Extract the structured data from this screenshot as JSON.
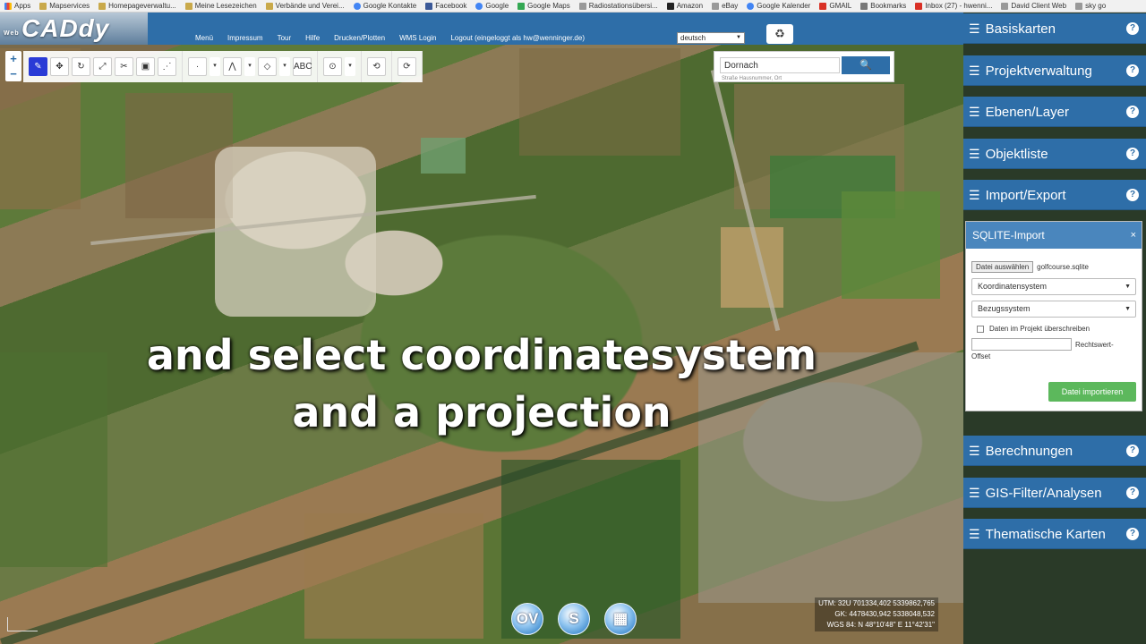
{
  "bookmarks": [
    {
      "label": "Apps",
      "icon": "apps"
    },
    {
      "label": "Mapservices",
      "icon": "folder"
    },
    {
      "label": "Homepageverwaltu...",
      "icon": "folder"
    },
    {
      "label": "Meine Lesezeichen",
      "icon": "folder"
    },
    {
      "label": "Verbände und Verei...",
      "icon": "folder"
    },
    {
      "label": "Google Kontakte",
      "icon": "g"
    },
    {
      "label": "Facebook",
      "icon": "fb"
    },
    {
      "label": "Google",
      "icon": "g"
    },
    {
      "label": "Google Maps",
      "icon": "maps"
    },
    {
      "label": "Radiostationsübersi...",
      "icon": "gray"
    },
    {
      "label": "Amazon",
      "icon": "amz"
    },
    {
      "label": "eBay",
      "icon": "gray"
    },
    {
      "label": "Google Kalender",
      "icon": "g"
    },
    {
      "label": "GMAIL",
      "icon": "red"
    },
    {
      "label": "Bookmarks",
      "icon": "star"
    },
    {
      "label": "Inbox (27) - hwenni...",
      "icon": "red"
    },
    {
      "label": "David Client Web",
      "icon": "gray"
    },
    {
      "label": "sky go",
      "icon": "gray"
    }
  ],
  "logo": {
    "text": "CADdy",
    "small": "Web"
  },
  "menu": [
    "Menü",
    "Impressum",
    "Tour",
    "Hilfe",
    "Drucken/Plotten",
    "WMS Login",
    "Logout (eingeloggt als hw@wenninger.de)"
  ],
  "language": "deutsch",
  "zoom": {
    "in": "+",
    "out": "−"
  },
  "toolbar": {
    "group1": [
      "✎",
      "✥",
      "↻",
      "⤢",
      "✂",
      "▣",
      "⋰"
    ],
    "group2": [
      "·",
      "▾",
      "⋀",
      "▾",
      "◇",
      "▾",
      "ABC"
    ],
    "group3": [
      "⊙",
      "▾"
    ],
    "group4": [
      "⟲"
    ],
    "group5": [
      "⟳"
    ]
  },
  "search": {
    "value": "Dornach",
    "hint": "Straße Hausnummer, Ort",
    "button": "🔍"
  },
  "panel": {
    "items_top": [
      "Basiskarten",
      "Projektverwaltung",
      "Ebenen/Layer",
      "Objektliste",
      "Import/Export"
    ],
    "items_bottom": [
      "Berechnungen",
      "GIS-Filter/Analysen",
      "Thematische Karten"
    ],
    "help": "?"
  },
  "sqlite": {
    "title": "SQLITE-Import",
    "close": "×",
    "file_button": "Datei auswählen",
    "file_name": "golfcourse.sqlite",
    "coord_system": "Koordinatensystem",
    "ref_system": "Bezugssystem",
    "overwrite": "Daten im Projekt überschreiben",
    "offset_label": "Rechtswert-",
    "offset_label2": "Offset",
    "import_button": "Datei importieren"
  },
  "caption": {
    "line1": "and select coordinatesystem",
    "line2": "and a projection"
  },
  "bottom_buttons": [
    "OV",
    "S",
    "▦"
  ],
  "coords": {
    "utm": "UTM: 32U 701334,402 5339862,765",
    "gk": "GK: 4478430,942 5338048,532",
    "wgs": "WGS 84: N 48°10'48\" E 11°42'31\""
  },
  "colors": {
    "nav": "#2e6ea8",
    "import": "#5cb85c",
    "active_tool": "#2a3bd6"
  }
}
